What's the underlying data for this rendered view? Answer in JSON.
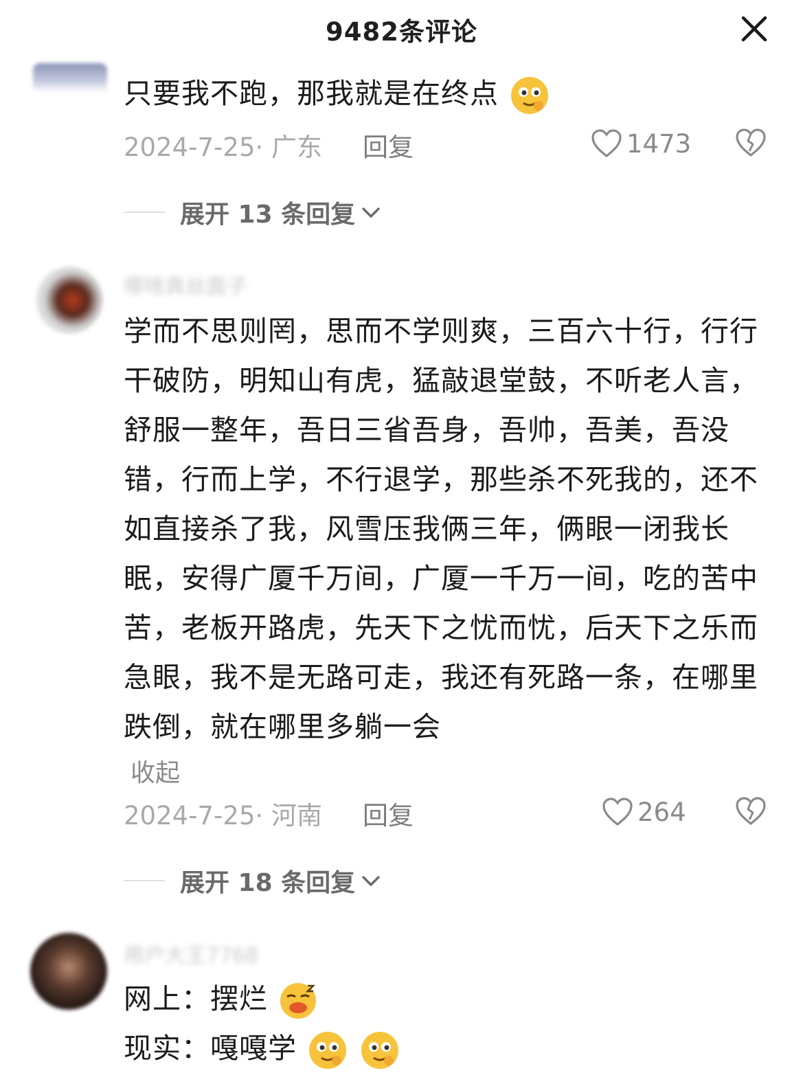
{
  "header": {
    "title": "9482条评论"
  },
  "comments": [
    {
      "username": "",
      "text": "只要我不跑，那我就是在终点",
      "date": "2024-7-25· 广东",
      "reply_label": "回复",
      "likes": "1473",
      "expand_label": "展开 13 条回复"
    },
    {
      "username": "哪啥真丝面子",
      "text": "学而不思则罔，思而不学则爽，三百六十行，行行干破防，明知山有虎，猛敲退堂鼓，不听老人言，舒服一整年，吾日三省吾身，吾帅，吾美，吾没错，行而上学，不行退学，那些杀不死我的，还不如直接杀了我，风雪压我俩三年，俩眼一闭我长眠，安得广厦千万间，广厦一千万一间，吃的苦中苦，老板开路虎，先天下之忧而忧，后天下之乐而急眼，我不是无路可走，我还有死路一条，在哪里跌倒，就在哪里多躺一会",
      "collapse_label": "收起",
      "date": "2024-7-25· 河南",
      "reply_label": "回复",
      "likes": "264",
      "expand_label": "展开 18 条回复"
    },
    {
      "username": "用户大王7768",
      "lines": [
        {
          "label": "网上：",
          "text": "摆烂"
        },
        {
          "label": "现实：",
          "text": "嘎嘎学"
        }
      ]
    }
  ],
  "icons": {
    "close": "close-icon",
    "like": "heart-icon",
    "dislike": "broken-heart-icon",
    "expand": "chevron-down-icon",
    "emoji_smirk": "smirk-emoji",
    "emoji_sleep": "sleepy-emoji"
  },
  "colors": {
    "text": "#1b1b1b",
    "meta": "#a9a9a9",
    "action": "#7d7d7d",
    "emoji": "#f6c33a"
  }
}
